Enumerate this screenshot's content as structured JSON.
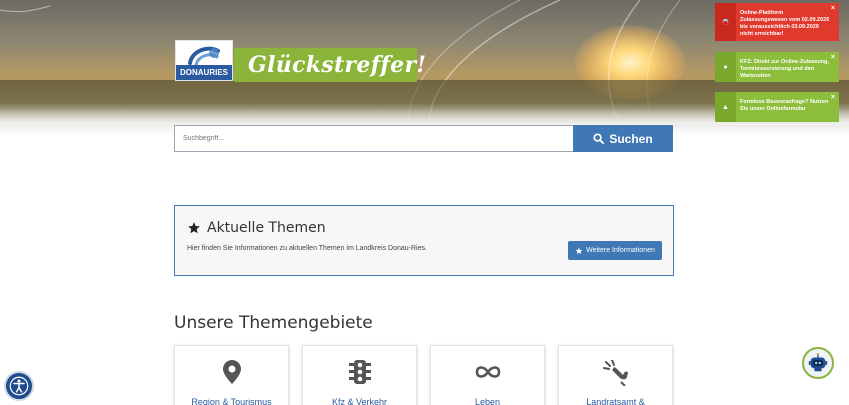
{
  "header": {
    "logo_text": "DONAURIES",
    "slogan": "Glückstreffer!"
  },
  "notifications": [
    {
      "text": "Online-Plattform Zulassungswesen vom 02.09.2026 bis voraussichtlich 03.09.2026 nicht erreichbar!",
      "icon": "car-icon",
      "color": "#e03a2e"
    },
    {
      "text": "KFZ: Direkt zur Online-Zulassung, Terminreservierung und den Wartezeiten",
      "icon": "info-icon",
      "color": "#8dbe3b"
    },
    {
      "text": "Formlose Bauvoranfrage? Nutzen Sie unser Onlineformular",
      "icon": "home-icon",
      "color": "#8dbe3b"
    }
  ],
  "notification_close": "×",
  "search": {
    "placeholder": "Suchbegriff...",
    "button_label": "Suchen"
  },
  "current_topics": {
    "title": "Aktuelle Themen",
    "description": "Hier finden Sie Informationen zu aktuellen Themen im Landkreis Donau-Ries.",
    "button_label": "Weitere Informationen"
  },
  "topic_areas": {
    "title": "Unsere Themengebiete",
    "cards": [
      {
        "label": "Region & Tourismus",
        "icon": "map-pin-icon"
      },
      {
        "label": "Kfz & Verkehr",
        "icon": "traffic-light-icon"
      },
      {
        "label": "Leben",
        "icon": "infinity-icon"
      },
      {
        "label": "Landratsamt &",
        "icon": "hand-signal-icon"
      }
    ]
  },
  "colors": {
    "brand_blue": "#3f78b5",
    "brand_green": "#8ab43a",
    "alert_red": "#e03a2e"
  }
}
